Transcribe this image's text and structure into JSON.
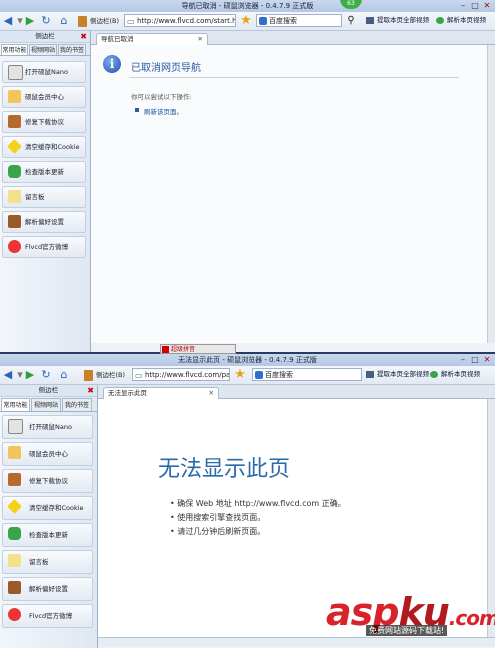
{
  "window1": {
    "title": "导航已取消 - 硕鼠浏览器 - 0.4.7.9 正式版",
    "badge": "63",
    "sidebar_toggle": "侧边栏(B)",
    "url": "http://www.flvcd.com/start.htm",
    "search_engine": "百度搜索",
    "link_extract": "提取本页全部视频",
    "link_parse": "解析本页视频",
    "sidebar": {
      "title": "侧边栏",
      "tabs": [
        "常用功能",
        "视频网站",
        "我的书签"
      ],
      "items": [
        "打开硕鼠Nano",
        "硕鼠会员中心",
        "修复下载协议",
        "清空缓存和Cookie",
        "检查版本更新",
        "留言板",
        "解析偏好设置",
        "Flvcd官方微博"
      ]
    },
    "tab_label": "导航已取消",
    "page": {
      "heading": "已取消网页导航",
      "subtext": "你可以尝试以下操作:",
      "action": "刷新该页面。"
    },
    "ime": "超级拼音"
  },
  "window2": {
    "title": "无法显示此页 - 硕鼠浏览器 - 0.4.7.9 正式版",
    "sidebar_toggle": "侧边栏(B)",
    "url": "http://www.flvcd.com/parse",
    "search_engine": "百度搜索",
    "link_extract": "提取本页全部视频",
    "link_parse": "解析本页视频",
    "sidebar": {
      "title": "侧边栏",
      "tabs": [
        "常用功能",
        "视频网站",
        "我的书签"
      ],
      "items": [
        "打开硕鼠Nano",
        "硕鼠会员中心",
        "修复下载协议",
        "清空缓存和Cookie",
        "检查版本更新",
        "留言板",
        "解析偏好设置",
        "Flvcd官方微博"
      ]
    },
    "tab_label": "无法显示此页",
    "page": {
      "heading": "无法显示此页",
      "bullets": [
        "确保 Web 地址 http://www.flvcd.com 正确。",
        "使用搜索引擎查找页面。",
        "请过几分钟后刷新页面。"
      ]
    }
  },
  "watermark": {
    "brand": "asp",
    "ku": "ku",
    "suffix": ".com",
    "caption": "免费网站源码下载站!"
  }
}
